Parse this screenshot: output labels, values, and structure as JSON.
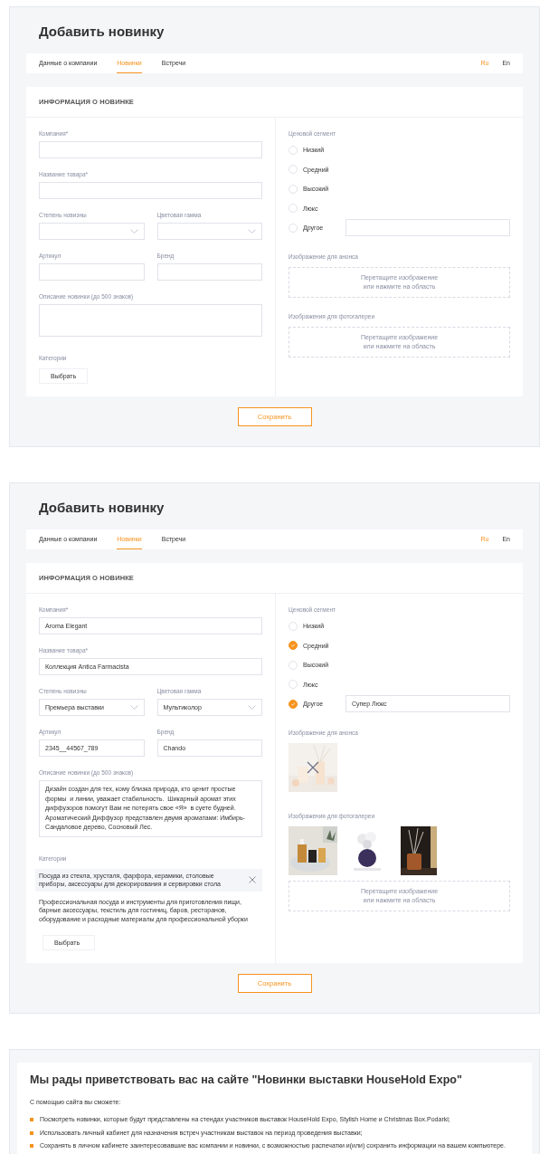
{
  "forms": [
    {
      "title": "Добавить новинку",
      "tabs": [
        {
          "label": "Данные о компании",
          "selected": false
        },
        {
          "label": "Новинки",
          "selected": true
        },
        {
          "label": "Встречи",
          "selected": false
        }
      ],
      "languages": [
        {
          "label": "Ru",
          "selected": true
        },
        {
          "label": "En",
          "selected": false
        }
      ],
      "section_title": "ИНФОРМАЦИЯ О НОВИНКЕ",
      "rows": [
        [
          {
            "kind": "text",
            "label": "Компания*"
          }
        ],
        [
          {
            "kind": "text",
            "label": "Название товара*"
          }
        ],
        [
          {
            "kind": "select",
            "label": "Степень новизны"
          },
          {
            "kind": "select",
            "label": "Цветовая гамма"
          }
        ],
        [
          {
            "kind": "text",
            "label": "Артикул"
          },
          {
            "kind": "text",
            "label": "Бренд"
          }
        ],
        [
          {
            "kind": "textarea",
            "label": "Описание новинки (до 500 знаков)"
          }
        ]
      ],
      "categories": {
        "label": "Категории",
        "button": "Выбрать"
      },
      "price_segment": {
        "label": "Ценовой сегмент",
        "options": [
          {
            "kind": "plain",
            "label": "Низкий",
            "checked": false
          },
          {
            "kind": "plain",
            "label": "Средний",
            "checked": false
          },
          {
            "kind": "plain",
            "label": "Высокий",
            "checked": false
          },
          {
            "kind": "plain",
            "label": "Люкс",
            "checked": false
          },
          {
            "kind": "other",
            "label": "Другое",
            "checked": false
          }
        ]
      },
      "announce_image": {
        "label": "Изображение для анонса",
        "dropzone": [
          "Перетащите изображение",
          "или нажмите на область"
        ]
      },
      "gallery": {
        "label": "Изображения для фотогалереи",
        "dropzone": [
          "Перетащите изображение",
          "или нажмите на область"
        ]
      },
      "save_button": "Сохранить"
    },
    {
      "title": "Добавить новинку",
      "tabs": [
        {
          "label": "Данные о компании",
          "selected": false
        },
        {
          "label": "Новинки",
          "selected": true
        },
        {
          "label": "Встречи",
          "selected": false
        }
      ],
      "languages": [
        {
          "label": "Ru",
          "selected": true
        },
        {
          "label": "En",
          "selected": false
        }
      ],
      "section_title": "ИНФОРМАЦИЯ О НОВИНКЕ",
      "rows": [
        [
          {
            "kind": "text",
            "label": "Компания*",
            "value": "Aroma Elegant"
          }
        ],
        [
          {
            "kind": "text",
            "label": "Название товара*",
            "value": "Коллекция Antica Farmacista"
          }
        ],
        [
          {
            "kind": "select",
            "label": "Степень новизны",
            "value": "Премьера выставки"
          },
          {
            "kind": "select",
            "label": "Цветовая гамма",
            "value": "Мультиколор"
          }
        ],
        [
          {
            "kind": "text",
            "label": "Артикул",
            "value": "2345__44567_789"
          },
          {
            "kind": "text",
            "label": "Бренд",
            "value": "Chando"
          }
        ],
        [
          {
            "kind": "textarea",
            "label": "Описание новинки (до 500 знаков)",
            "value": "Дизайн создан для тех, кому близка природа, кто ценит простые формы  и линии, уважает стабильность.  Шикарный аромат этих диффузоров помогут Вам не потерять свое «Я»  в суете будней. Ароматический Диффузор представлен двумя ароматами: Имбирь-Сандаловое дерево, Сосновый Лес."
          }
        ]
      ],
      "categories": {
        "label": "Категории",
        "button": "Выбрать",
        "items": [
          {
            "text": "Посуда из стекла, хрусталя, фарфора, керамики, столовые приборы, аксессуары для декорирования и сервировки стола",
            "highlighted": true
          },
          {
            "text": "Профессиональная посуда и инструменты для приготовления пищи, барные аксессуары, текстиль для гостиниц, баров, ресторанов, оборудование и расходные материалы для профессиональной уборки",
            "highlighted": false
          }
        ]
      },
      "price_segment": {
        "label": "Ценовой сегмент",
        "other_value": "Супер Люкс",
        "options": [
          {
            "kind": "plain",
            "label": "Низкий",
            "checked": false
          },
          {
            "kind": "plain",
            "label": "Средний",
            "checked": true
          },
          {
            "kind": "plain",
            "label": "Высокий",
            "checked": false
          },
          {
            "kind": "plain",
            "label": "Люкс",
            "checked": false
          },
          {
            "kind": "other",
            "label": "Другое",
            "checked": true
          }
        ]
      },
      "announce_image": {
        "label": "Изображение для анонса",
        "images": [
          {
            "kind": "picture",
            "remove_overlay": true
          }
        ]
      },
      "gallery": {
        "label": "Изображения для фотогалереи",
        "images": [
          {
            "kind": "picture",
            "remove_overlay": false
          },
          {
            "kind": "picture",
            "remove_overlay": false
          },
          {
            "kind": "picture",
            "remove_overlay": false
          }
        ],
        "dropzone": [
          "Перетащите изображение",
          "или нажмите на область"
        ]
      },
      "save_button": "Сохранить"
    }
  ],
  "welcome": {
    "title": "Мы рады приветствовать вас на сайте \"Новинки выставки HouseHold Expo\"",
    "intro": "С помощью сайта вы сможете:",
    "bullets": [
      "Посмотреть новинки, которые будут представлены на стендах участников выставок HouseHold Expo, Stylish Home и Christmas Box.Podarki;",
      "Использовать личный кабинет для назначения встреч участникам выставок на период проведения выставки;",
      "Сохранять в личном кабинете заинтересовавшие вас компании и новинки, с возможностью распечатки и(или) сохранить информации на вашем компьютере."
    ]
  }
}
